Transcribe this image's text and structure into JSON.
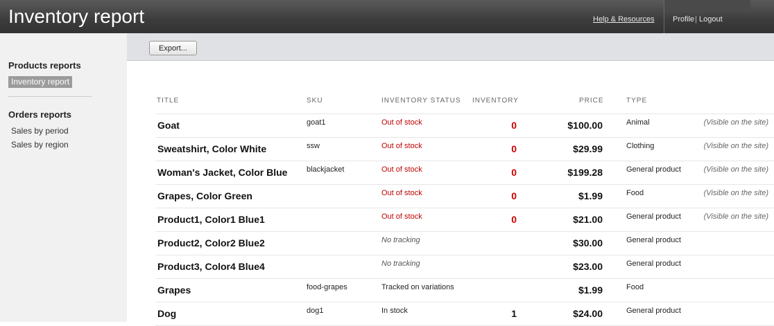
{
  "header": {
    "title": "Inventory report",
    "help_link": "Help & Resources",
    "profile": "Profile",
    "separator": "|",
    "logout": "Logout"
  },
  "sidebar": {
    "sections": [
      {
        "heading": "Products reports",
        "items": [
          "Inventory report"
        ]
      },
      {
        "heading": "Orders reports",
        "items": [
          "Sales by period",
          "Sales by region"
        ]
      }
    ],
    "active_item": "Inventory report"
  },
  "toolbar": {
    "export_label": "Export..."
  },
  "table": {
    "columns": [
      "TITLE",
      "SKU",
      "INVENTORY STATUS",
      "INVENTORY",
      "PRICE",
      "TYPE"
    ],
    "rows": [
      {
        "title": "Goat",
        "sku": "goat1",
        "status": "Out of stock",
        "inventory": "0",
        "price": "$100.00",
        "type": "Animal",
        "visibility": "(Visible on the site)"
      },
      {
        "title": "Sweatshirt, Color White",
        "sku": "ssw",
        "status": "Out of stock",
        "inventory": "0",
        "price": "$29.99",
        "type": "Clothing",
        "visibility": "(Visible on the site)"
      },
      {
        "title": "Woman's Jacket, Color Blue",
        "sku": "blackjacket",
        "status": "Out of stock",
        "inventory": "0",
        "price": "$199.28",
        "type": "General product",
        "visibility": "(Visible on the site)"
      },
      {
        "title": "Grapes, Color Green",
        "sku": "",
        "status": "Out of stock",
        "inventory": "0",
        "price": "$1.99",
        "type": "Food",
        "visibility": "(Visible on the site)"
      },
      {
        "title": "Product1, Color1 Blue1",
        "sku": "",
        "status": "Out of stock",
        "inventory": "0",
        "price": "$21.00",
        "type": "General product",
        "visibility": "(Visible on the site)"
      },
      {
        "title": "Product2, Color2 Blue2",
        "sku": "",
        "status": "No tracking",
        "inventory": "",
        "price": "$30.00",
        "type": "General product",
        "visibility": ""
      },
      {
        "title": "Product3, Color4 Blue4",
        "sku": "",
        "status": "No tracking",
        "inventory": "",
        "price": "$23.00",
        "type": "General product",
        "visibility": ""
      },
      {
        "title": "Grapes",
        "sku": "food-grapes",
        "status": "Tracked on variations",
        "inventory": "",
        "price": "$1.99",
        "type": "Food",
        "visibility": ""
      },
      {
        "title": "Dog",
        "sku": "dog1",
        "status": "In stock",
        "inventory": "1",
        "price": "$24.00",
        "type": "General product",
        "visibility": ""
      }
    ]
  },
  "colors": {
    "out_of_stock": "#c00000",
    "no_tracking": "#555555",
    "default_status": "#222222",
    "inventory_zero": "#cc0000",
    "inventory_positive": "#111111"
  }
}
